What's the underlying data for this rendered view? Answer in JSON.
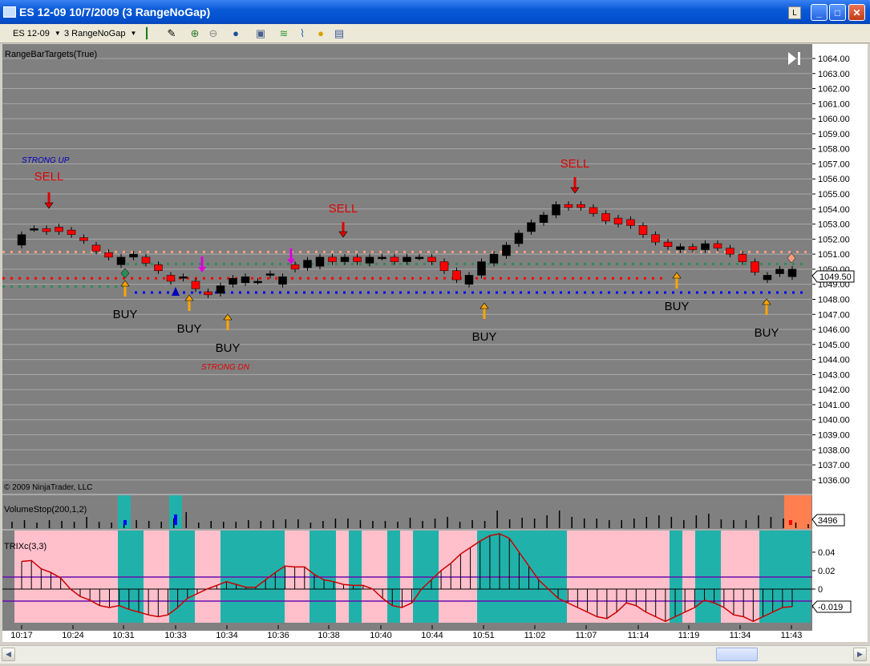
{
  "window": {
    "title": "ES 12-09  10/7/2009 (3 RangeNoGap)",
    "lock_label": "L",
    "min": "_",
    "max": "□",
    "close": "✕"
  },
  "toolbar": {
    "instrument": "ES 12-09",
    "period": "3 RangeNoGap"
  },
  "chart": {
    "indicator_label": "RangeBarTargets(True)",
    "copyright": "© 2009 NinjaTrader, LLC",
    "price_axis": [
      "1064.00",
      "1063.00",
      "1062.00",
      "1061.00",
      "1060.00",
      "1059.00",
      "1058.00",
      "1057.00",
      "1056.00",
      "1055.00",
      "1054.00",
      "1053.00",
      "1052.00",
      "1051.00",
      "1050.00",
      "1049.00",
      "1048.00",
      "1047.00",
      "1046.00",
      "1045.00",
      "1044.00",
      "1043.00",
      "1042.00",
      "1041.00",
      "1040.00",
      "1039.00",
      "1038.00",
      "1037.00",
      "1036.00"
    ],
    "last_price": "1049.50",
    "strong_up": "STRONG UP",
    "strong_dn": "STRONG DN",
    "signals": [
      {
        "label": "SELL",
        "type": "sell"
      },
      {
        "label": "SELL",
        "type": "sell"
      },
      {
        "label": "SELL",
        "type": "sell"
      },
      {
        "label": "BUY",
        "type": "buy"
      },
      {
        "label": "BUY",
        "type": "buy"
      },
      {
        "label": "BUY",
        "type": "buy"
      },
      {
        "label": "BUY",
        "type": "buy"
      },
      {
        "label": "BUY",
        "type": "buy"
      },
      {
        "label": "BUY",
        "type": "buy"
      }
    ],
    "colors": {
      "up_bar": "#000000",
      "down_bar": "#ff0000",
      "sell": "#e00000",
      "buy": "#ffa500",
      "target_salmon": "#f4a080",
      "target_green": "#2e8b57",
      "target_red": "#ff0000",
      "target_blue": "#0000ff",
      "panel_pink": "#ffc0cb",
      "panel_teal": "#20b2aa"
    }
  },
  "volume_panel": {
    "label": "VolumeStop(200,1,2)",
    "value": "3496"
  },
  "trix_panel": {
    "label": "TRIXc(3,3)",
    "axis": [
      "0.04",
      "0.02",
      "0",
      "-0.02"
    ],
    "value": "-0.019"
  },
  "time_axis": [
    "10:17",
    "10:24",
    "10:31",
    "10:33",
    "10:34",
    "10:36",
    "10:38",
    "10:40",
    "10:44",
    "10:51",
    "11:02",
    "11:07",
    "11:14",
    "11:19",
    "11:34",
    "11:43"
  ],
  "chart_data": {
    "type": "candlestick",
    "closes": [
      1052.3,
      1052.7,
      1052.5,
      1052.5,
      1052.3,
      1051.9,
      1051.2,
      1050.8,
      1050.8,
      1051.0,
      1050.4,
      1049.9,
      1049.2,
      1049.5,
      1048.7,
      1048.3,
      1048.9,
      1049.4,
      1049.5,
      1049.2,
      1049.7,
      1049.5,
      1050.0,
      1050.6,
      1050.8,
      1050.5,
      1050.8,
      1050.5,
      1050.8,
      1050.8,
      1050.5,
      1050.8,
      1050.8,
      1050.5,
      1049.9,
      1049.3,
      1049.6,
      1050.5,
      1051.0,
      1051.6,
      1052.4,
      1053.1,
      1053.6,
      1054.3,
      1054.1,
      1054.1,
      1053.7,
      1053.2,
      1053.0,
      1052.9,
      1052.3,
      1051.8,
      1051.5,
      1051.5,
      1051.3,
      1051.7,
      1051.4,
      1051.0,
      1050.5,
      1049.8,
      1049.6,
      1050.0,
      1050.0
    ],
    "opens": [
      1051.6,
      1052.7,
      1052.7,
      1052.8,
      1052.6,
      1052.1,
      1051.6,
      1051.1,
      1050.3,
      1050.8,
      1050.8,
      1050.3,
      1049.6,
      1049.4,
      1049.2,
      1048.5,
      1048.4,
      1049.0,
      1049.1,
      1049.2,
      1049.6,
      1049.0,
      1050.3,
      1050.1,
      1050.2,
      1050.8,
      1050.5,
      1050.8,
      1050.4,
      1050.8,
      1050.8,
      1050.5,
      1050.8,
      1050.8,
      1050.5,
      1049.9,
      1049.0,
      1049.6,
      1050.4,
      1050.9,
      1051.7,
      1052.5,
      1053.1,
      1053.6,
      1054.3,
      1054.3,
      1054.1,
      1053.7,
      1053.4,
      1053.3,
      1052.9,
      1052.3,
      1051.8,
      1051.3,
      1051.5,
      1051.3,
      1051.7,
      1051.4,
      1051.0,
      1050.5,
      1049.3,
      1049.7,
      1049.5
    ],
    "trix": [
      0.03,
      0.031,
      0.022,
      0.018,
      0.012,
      0.0,
      -0.008,
      -0.012,
      -0.018,
      -0.02,
      -0.018,
      -0.022,
      -0.025,
      -0.028,
      -0.03,
      -0.028,
      -0.02,
      -0.01,
      -0.005,
      0.0,
      0.004,
      0.008,
      0.005,
      0.002,
      0.002,
      0.01,
      0.018,
      0.025,
      0.024,
      0.024,
      0.016,
      0.01,
      0.008,
      0.005,
      0.004,
      0.004,
      0.0,
      -0.01,
      -0.018,
      -0.02,
      -0.015,
      0.0,
      0.01,
      0.02,
      0.028,
      0.038,
      0.045,
      0.052,
      0.058,
      0.06,
      0.055,
      0.04,
      0.025,
      0.01,
      0.0,
      -0.01,
      -0.015,
      -0.02,
      -0.025,
      -0.03,
      -0.032,
      -0.025,
      -0.015,
      -0.018,
      -0.025,
      -0.03,
      -0.035,
      -0.03,
      -0.025,
      -0.02,
      -0.012,
      -0.015,
      -0.02,
      -0.028,
      -0.03,
      -0.035,
      -0.03,
      -0.025,
      -0.02,
      -0.019
    ]
  }
}
